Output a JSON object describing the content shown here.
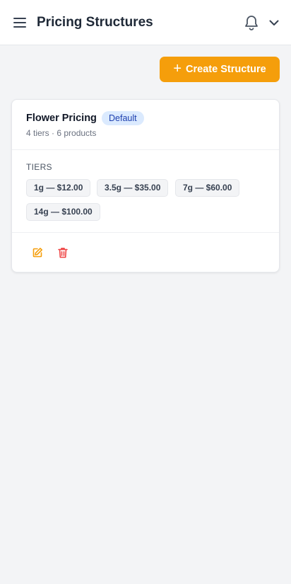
{
  "header": {
    "title": "Pricing Structures",
    "icons": [
      "menu-icon",
      "bell-icon",
      "chevron-down-icon"
    ]
  },
  "toolbar": {
    "create_label": "Create Structure",
    "create_icon": "plus-icon",
    "accent_color": "#f59e0b"
  },
  "structures": [
    {
      "name": "Flower Pricing",
      "badge": "Default",
      "summary": "4 tiers · 6 products",
      "tiers_heading": "TIERS",
      "tiers": [
        "1g — $12.00",
        "3.5g — $35.00",
        "7g — $60.00",
        "14g — $100.00"
      ],
      "actions": [
        "edit-icon",
        "trash-icon"
      ]
    }
  ],
  "colors": {
    "badge_bg": "#dbeafe",
    "badge_text": "#1e40af",
    "delete": "#ef4444",
    "edit": "#f59e0b"
  }
}
